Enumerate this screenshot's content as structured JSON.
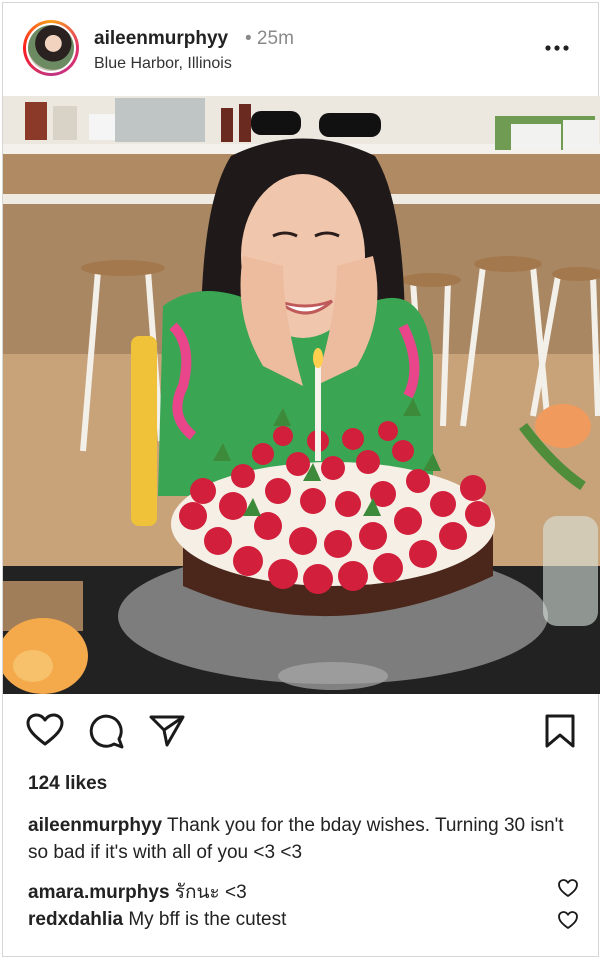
{
  "post": {
    "username": "aileenmurphyy",
    "time": "• 25m",
    "location": "Blue Harbor, Illinois",
    "likes": "124 likes",
    "caption": {
      "username": "aileenmurphyy",
      "text": "Thank you for the bday wishes. Turning 30 isn't so bad if it's with all of you <3 <3"
    }
  },
  "comments": [
    {
      "username": "amara.murphys",
      "text": "รักนะ <3"
    },
    {
      "username": "redxdahlia",
      "text": "My bff is the cutest"
    }
  ],
  "icons": {
    "more": "more-options-icon",
    "like": "heart-icon",
    "comment": "comment-bubble-icon",
    "share": "paper-plane-icon",
    "save": "bookmark-icon"
  },
  "colors": {
    "story_ring_start": "#f9a11b",
    "story_ring_mid": "#e1306c",
    "text": "#222222",
    "muted": "#8a8a8a"
  }
}
